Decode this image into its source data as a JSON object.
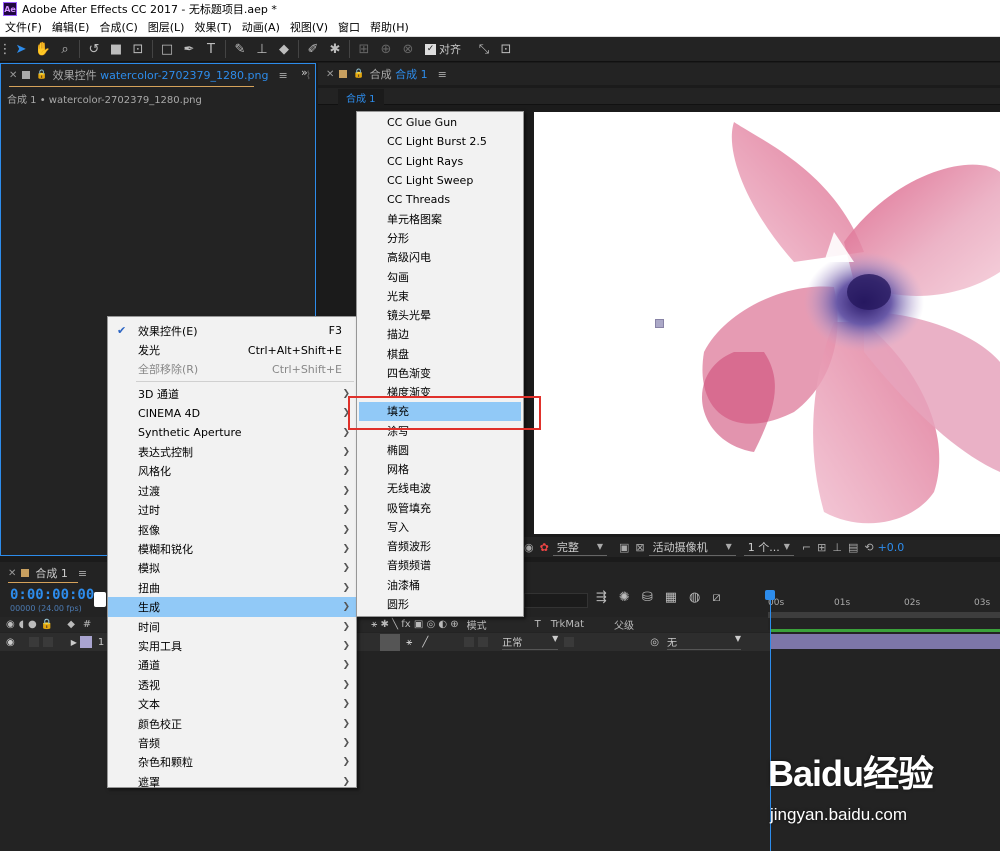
{
  "window": {
    "title": "Adobe After Effects CC 2017 - 无标题项目.aep *",
    "app_icon": "Ae"
  },
  "menubar": [
    "文件(F)",
    "编辑(E)",
    "合成(C)",
    "图层(L)",
    "效果(T)",
    "动画(A)",
    "视图(V)",
    "窗口",
    "帮助(H)"
  ],
  "toolbar": {
    "snap_label": "对齐"
  },
  "effects_panel": {
    "tab_prefix": "效果控件",
    "tab_file": "watercolor-2702379_1280.png",
    "breadcrumb": "合成 1 • watercolor-2702379_1280.png"
  },
  "comp_panel": {
    "tab_prefix": "合成",
    "tab_name": "合成 1",
    "sub_tab": "合成 1"
  },
  "viewer_controls": {
    "quality": "完整",
    "camera": "活动摄像机",
    "views": "1 个...",
    "exposure": "+0.0"
  },
  "timeline": {
    "tab": "合成 1",
    "timecode": "0:00:00:00",
    "fps": "00000 (24.00 fps)",
    "columns": {
      "mode": "模式",
      "t": "T",
      "trkmat": "TrkMat",
      "parent": "父级"
    },
    "layer": {
      "index": "1",
      "mode": "正常",
      "parent": "无"
    },
    "ruler": [
      "00s",
      "01s",
      "02s",
      "03s"
    ]
  },
  "context_menu": {
    "top_items": [
      {
        "label": "效果控件(E)",
        "shortcut": "F3",
        "checked": true,
        "disabled": false
      },
      {
        "label": "发光",
        "shortcut": "Ctrl+Alt+Shift+E",
        "checked": false,
        "disabled": false
      },
      {
        "label": "全部移除(R)",
        "shortcut": "Ctrl+Shift+E",
        "checked": false,
        "disabled": true
      }
    ],
    "categories": [
      "3D 通道",
      "CINEMA 4D",
      "Synthetic Aperture",
      "表达式控制",
      "风格化",
      "过渡",
      "过时",
      "抠像",
      "模糊和锐化",
      "模拟",
      "扭曲",
      "生成",
      "时间",
      "实用工具",
      "通道",
      "透视",
      "文本",
      "颜色校正",
      "音频",
      "杂色和颗粒",
      "遮罩"
    ],
    "highlighted": "生成"
  },
  "submenu": {
    "items": [
      "CC Glue Gun",
      "CC Light Burst 2.5",
      "CC Light Rays",
      "CC Light Sweep",
      "CC Threads",
      "单元格图案",
      "分形",
      "高级闪电",
      "勾画",
      "光束",
      "镜头光晕",
      "描边",
      "棋盘",
      "四色渐变",
      "梯度渐变",
      "填充",
      "涂写",
      "椭圆",
      "网格",
      "无线电波",
      "吸管填充",
      "写入",
      "音频波形",
      "音频频谱",
      "油漆桶",
      "圆形"
    ],
    "highlighted": "填充"
  },
  "watermark": {
    "logo": "Baidu经验",
    "url": "jingyan.baidu.com"
  }
}
